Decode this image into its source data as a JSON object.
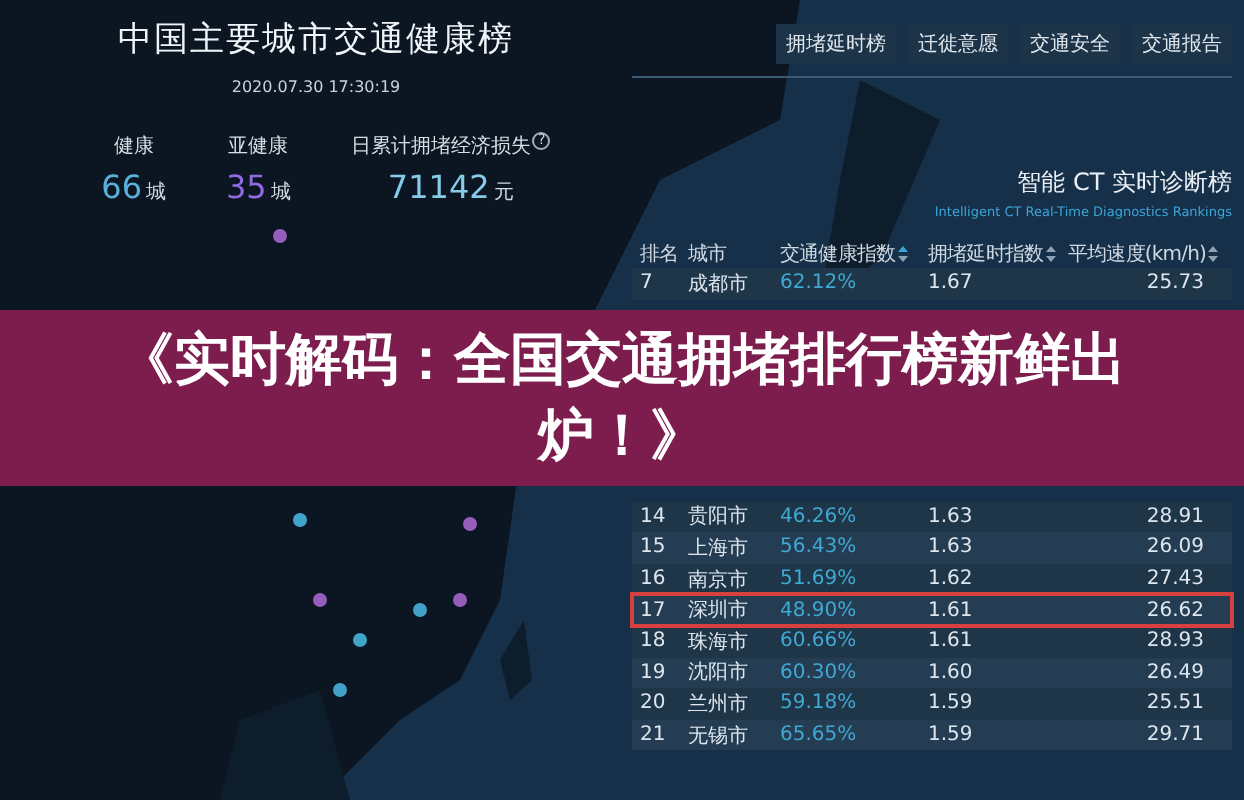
{
  "dashboard": {
    "title": "中国主要城市交通健康榜",
    "timestamp": "2020.07.30 17:30:19",
    "stats": [
      {
        "label": "健康",
        "value": "66",
        "unit": "城",
        "color": "#5ab0d8"
      },
      {
        "label": "亚健康",
        "value": "35",
        "unit": "城",
        "color": "#8f6ae0"
      },
      {
        "label": "日累计拥堵经济损失",
        "info": "?",
        "value": "71142",
        "unit": "元",
        "color": "#86cbe8"
      }
    ]
  },
  "nav": [
    {
      "label": "拥堵延时榜"
    },
    {
      "label": "迁徙意愿"
    },
    {
      "label": "交通安全"
    },
    {
      "label": "交通报告"
    }
  ],
  "ranking": {
    "title": "智能 CT 实时诊断榜",
    "subtitle": "Intelligent CT Real-Time Diagnostics Rankings",
    "columns": [
      {
        "label": "排名",
        "sortable": false
      },
      {
        "label": "城市",
        "sortable": false
      },
      {
        "label": "交通健康指数",
        "sortable": true
      },
      {
        "label": "拥堵延时指数",
        "sortable": true
      },
      {
        "label": "平均速度(km/h)",
        "sortable": true
      }
    ],
    "rows": [
      {
        "rank": "7",
        "city": "成都市",
        "health": "62.12%",
        "delay": "1.67",
        "speed": "25.73",
        "highlighted": false
      },
      {
        "rank": "14",
        "city": "贵阳市",
        "health": "46.26%",
        "delay": "1.63",
        "speed": "28.91",
        "highlighted": false
      },
      {
        "rank": "15",
        "city": "上海市",
        "health": "56.43%",
        "delay": "1.63",
        "speed": "26.09",
        "highlighted": false
      },
      {
        "rank": "16",
        "city": "南京市",
        "health": "51.69%",
        "delay": "1.62",
        "speed": "27.43",
        "highlighted": false
      },
      {
        "rank": "17",
        "city": "深圳市",
        "health": "48.90%",
        "delay": "1.61",
        "speed": "26.62",
        "highlighted": true
      },
      {
        "rank": "18",
        "city": "珠海市",
        "health": "60.66%",
        "delay": "1.61",
        "speed": "28.93",
        "highlighted": false
      },
      {
        "rank": "19",
        "city": "沈阳市",
        "health": "60.30%",
        "delay": "1.60",
        "speed": "26.49",
        "highlighted": false
      },
      {
        "rank": "20",
        "city": "兰州市",
        "health": "59.18%",
        "delay": "1.59",
        "speed": "25.51",
        "highlighted": false
      },
      {
        "rank": "21",
        "city": "无锡市",
        "health": "65.65%",
        "delay": "1.59",
        "speed": "29.71",
        "highlighted": false
      }
    ]
  },
  "banner": {
    "headline": "《实时解码：全国交通拥堵排行榜新鲜出炉！》"
  }
}
